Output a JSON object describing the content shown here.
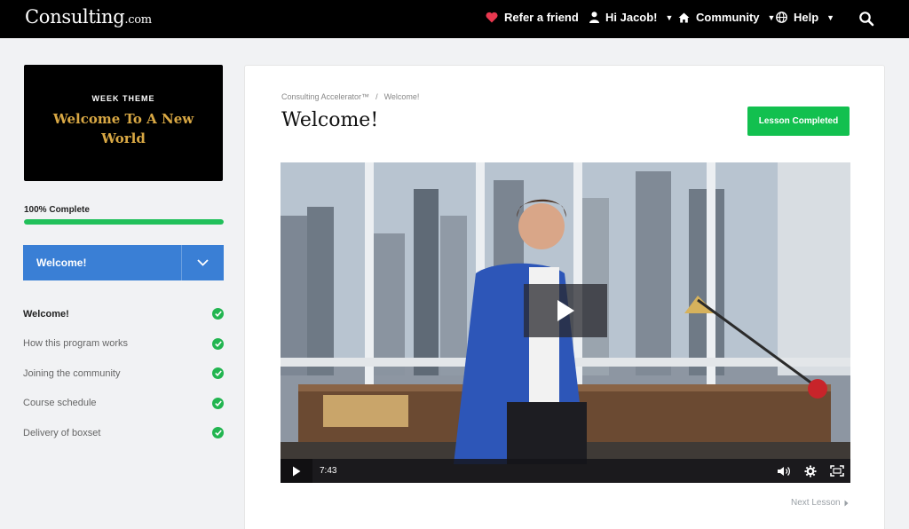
{
  "brand": {
    "name": "Consulting",
    "suffix": ".com"
  },
  "nav": {
    "refer": "Refer a friend",
    "user": "Hi Jacob!",
    "community": "Community",
    "help": "Help"
  },
  "icons": {
    "refer": "heart-icon",
    "user": "user-icon",
    "community": "home-icon",
    "help": "globe-icon",
    "search": "search-icon"
  },
  "colors": {
    "accent_green": "#12c04f",
    "module_blue": "#3a7fd5",
    "theme_gold": "#d9a844"
  },
  "theme_card": {
    "kicker": "WEEK THEME",
    "title": "Welcome To A New World"
  },
  "progress": {
    "label": "100% Complete",
    "value": 100
  },
  "module": {
    "selected": "Welcome!"
  },
  "lessons": [
    {
      "label": "Welcome!",
      "completed": true,
      "active": true
    },
    {
      "label": "How this program works",
      "completed": true,
      "active": false
    },
    {
      "label": "Joining the community",
      "completed": true,
      "active": false
    },
    {
      "label": "Course schedule",
      "completed": true,
      "active": false
    },
    {
      "label": "Delivery of boxset",
      "completed": true,
      "active": false
    }
  ],
  "breadcrumb": {
    "course": "Consulting Accelerator™",
    "separator": "/",
    "current": "Welcome!"
  },
  "page": {
    "title": "Welcome!",
    "complete_button": "Lesson Completed"
  },
  "video": {
    "duration": "7:43"
  },
  "next_lesson": "Next Lesson"
}
